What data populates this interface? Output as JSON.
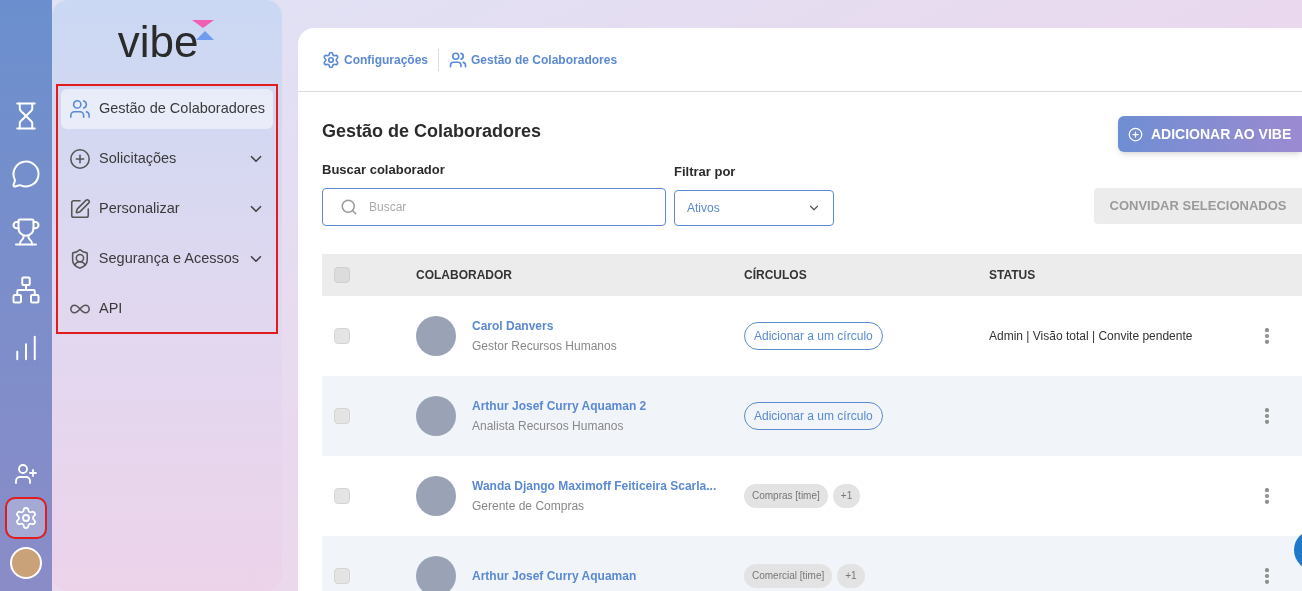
{
  "logo": {
    "text": "vibe"
  },
  "rail": {
    "items": [
      {
        "kind": "hourglass",
        "selected": false
      },
      {
        "kind": "chat",
        "selected": false
      },
      {
        "kind": "trophy",
        "selected": false
      },
      {
        "kind": "network",
        "selected": false
      },
      {
        "kind": "chart",
        "selected": false
      },
      {
        "kind": "add-user",
        "selected": false
      },
      {
        "kind": "gear",
        "selected": true
      }
    ]
  },
  "sidebar": {
    "items": [
      {
        "label": "Gestão de Colaboradores",
        "kind": "users",
        "selected": true,
        "expandable": false
      },
      {
        "label": "Solicitações",
        "kind": "plus",
        "selected": false,
        "expandable": true
      },
      {
        "label": "Personalizar",
        "kind": "edit",
        "selected": false,
        "expandable": true
      },
      {
        "label": "Segurança e Acessos",
        "kind": "shield",
        "selected": false,
        "expandable": true
      },
      {
        "label": "API",
        "kind": "infinity",
        "selected": false,
        "expandable": false
      }
    ]
  },
  "breadcrumb": [
    {
      "label": "Configurações",
      "kind": "gear"
    },
    {
      "label": "Gestão de Colaboradores",
      "kind": "users"
    }
  ],
  "page_title": "Gestão de Colaboradores",
  "add_button": "ADICIONAR AO VIBE",
  "search": {
    "label": "Buscar colaborador",
    "placeholder": "Buscar"
  },
  "filter": {
    "label": "Filtrar por",
    "value": "Ativos"
  },
  "invite_button": {
    "label": "CONVIDAR SELECIONADOS",
    "disabled": true
  },
  "table": {
    "header_checked": false,
    "columns": [
      "COLABORADOR",
      "CÍRCULOS",
      "STATUS"
    ],
    "rows": [
      {
        "name": "Carol Danvers",
        "role": "Gestor Recursos Humanos",
        "circle_button": "Adicionar a um círculo",
        "status": "Admin | Visão total | Convite pendente",
        "checked": false
      },
      {
        "name": "Arthur Josef Curry Aquaman 2",
        "role": "Analista Recursos Humanos",
        "circle_button": "Adicionar a um círculo",
        "checked": false
      },
      {
        "name": "Wanda Django Maximoff Feiticeira Scarla...",
        "role": "Gerente de Compras",
        "circles": [
          "Compras [time]",
          "+1"
        ],
        "checked": false
      },
      {
        "name": "Arthur Josef Curry Aquaman",
        "circles": [
          "Comercial [time]",
          "+1"
        ],
        "checked": false
      }
    ]
  }
}
